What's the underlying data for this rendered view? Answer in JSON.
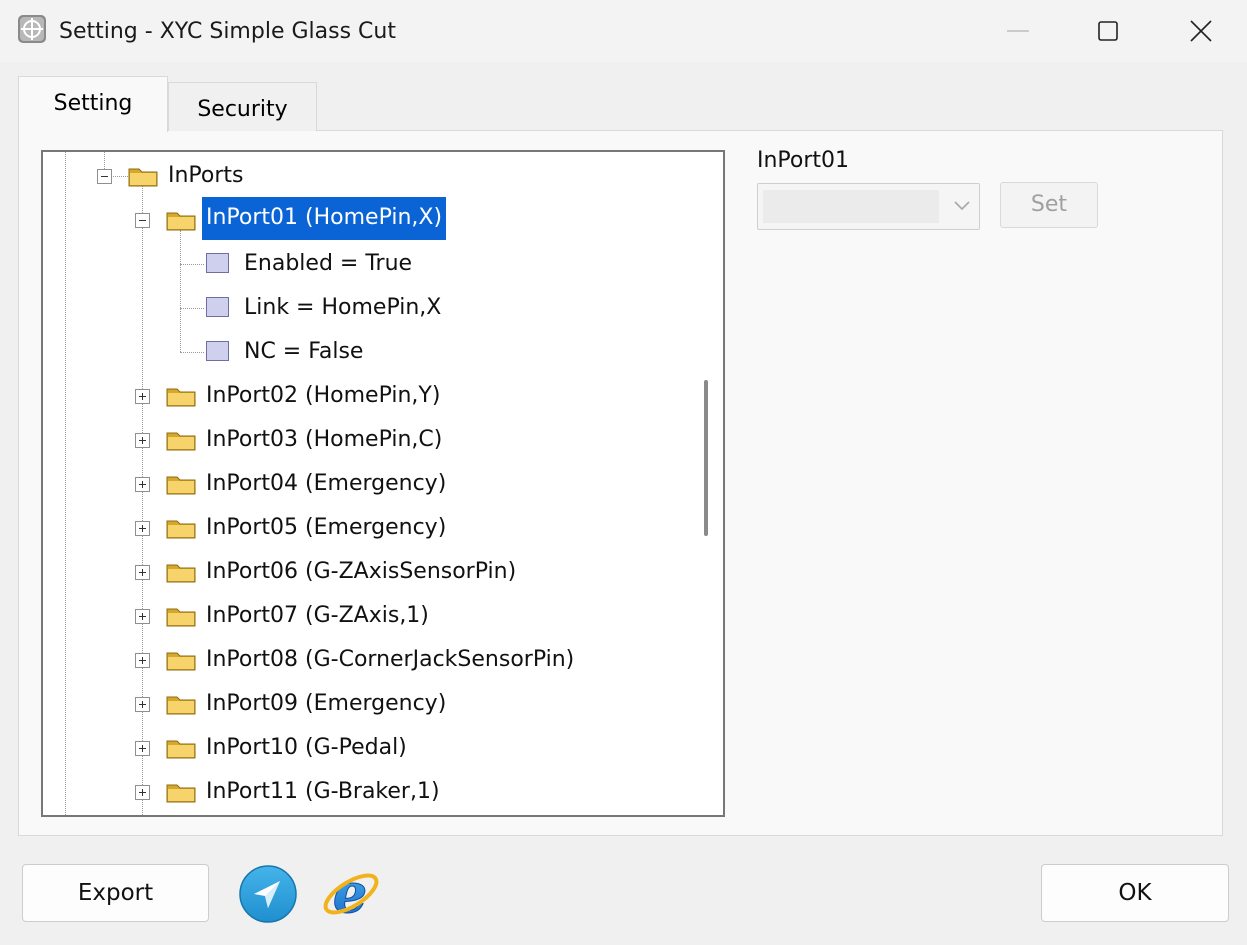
{
  "window": {
    "title": "Setting - XYC Simple Glass Cut",
    "app_icon": "crosshair-app-icon",
    "controls": [
      "minimize-icon",
      "maximize-icon",
      "close-icon"
    ]
  },
  "tabs": [
    {
      "label": "Setting",
      "active": true
    },
    {
      "label": "Security",
      "active": false
    }
  ],
  "tree": {
    "root": {
      "label": "InPorts",
      "expanded": true
    },
    "selected": {
      "label": "InPort01 (HomePin,X)",
      "expanded": true,
      "children": [
        "Enabled = True",
        "Link = HomePin,X",
        "NC = False"
      ]
    },
    "collapsed_items": [
      "InPort02 (HomePin,Y)",
      "InPort03 (HomePin,C)",
      "InPort04 (Emergency)",
      "InPort05 (Emergency)",
      "InPort06 (G-ZAxisSensorPin)",
      "InPort07 (G-ZAxis,1)",
      "InPort08 (G-CornerJackSensorPin)",
      "InPort09 (Emergency)",
      "InPort10 (G-Pedal)",
      "InPort11 (G-Braker,1)"
    ]
  },
  "property_panel": {
    "label": "InPort01",
    "combo_value": "",
    "set_label": "Set"
  },
  "footer": {
    "export_label": "Export",
    "ok_label": "OK",
    "icons": [
      "telegram-send-icon",
      "internet-explorer-icon"
    ]
  },
  "colors": {
    "selection": "#0a64d6",
    "folder": "#f2c94c",
    "leaf": "#cfcfee"
  }
}
